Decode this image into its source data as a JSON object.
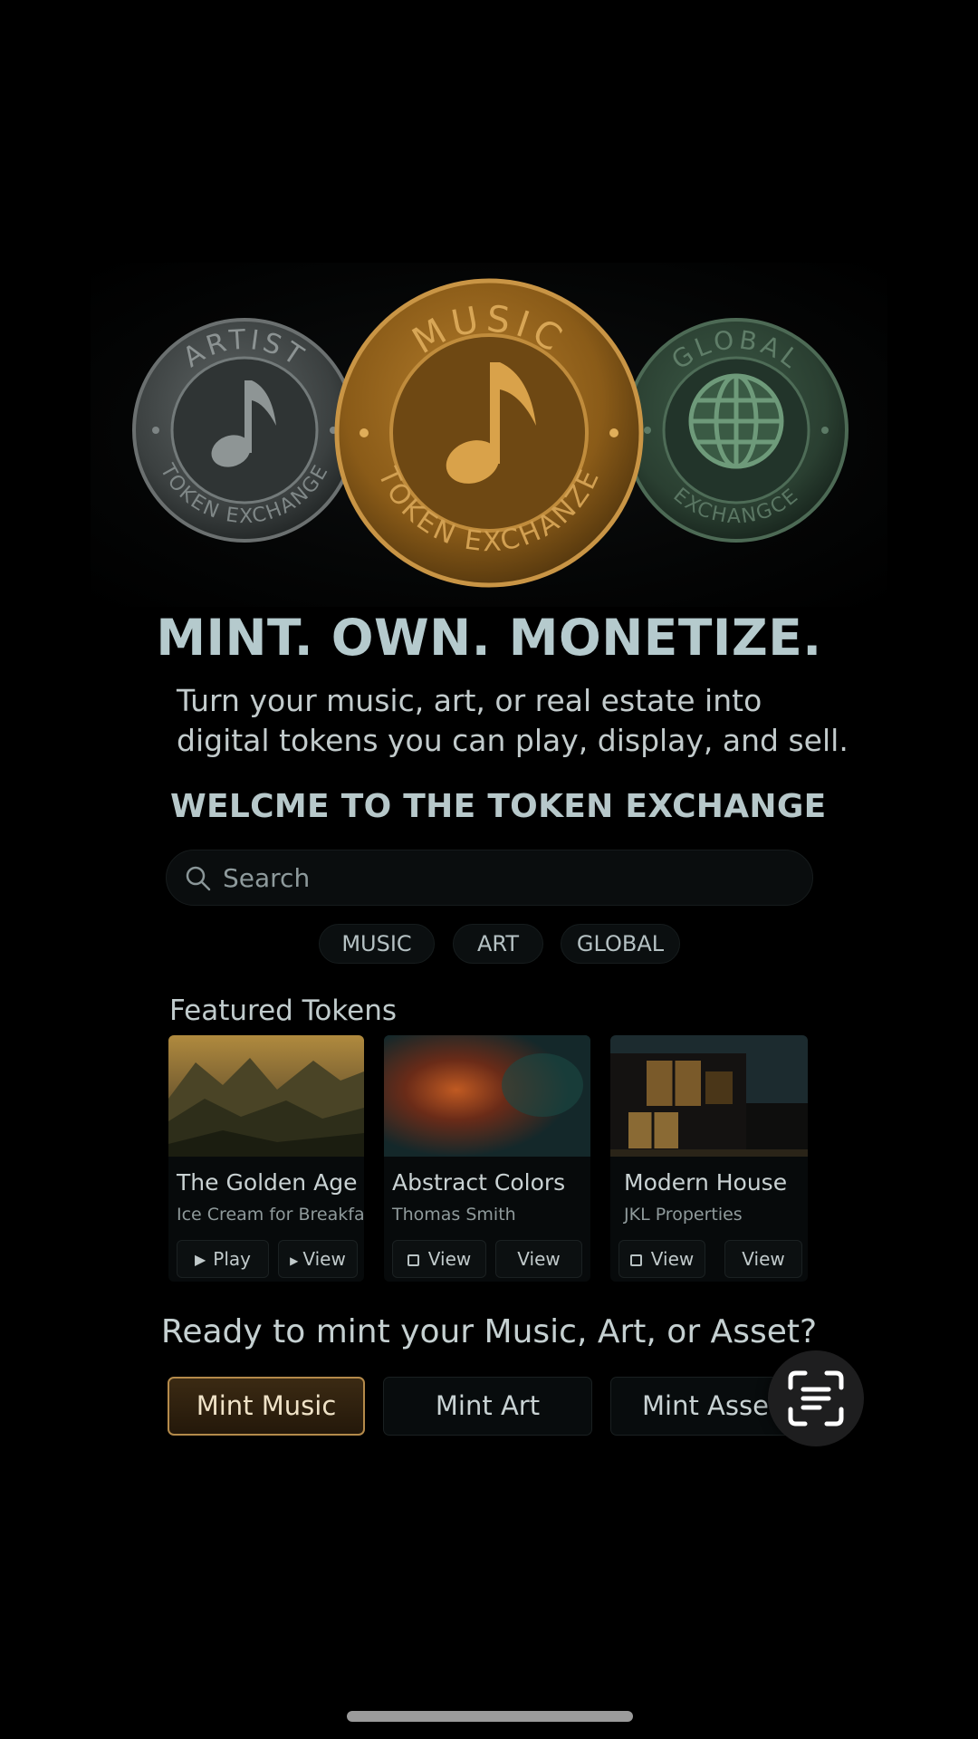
{
  "hero": {
    "coins": [
      {
        "top_text": "ARTIST",
        "bottom_text": "TOKEN EXCHANGE",
        "icon": "music-note-icon",
        "color": "#4a5050"
      },
      {
        "top_text": "MUSIC",
        "bottom_text": "TOKEN EXCHANZE",
        "icon": "music-note-icon",
        "color": "#a8701e"
      },
      {
        "top_text": "GLOBAL",
        "bottom_text": "EXCHANGCE",
        "icon": "globe-icon",
        "color": "#2f4a39"
      }
    ]
  },
  "headline": "MINT. OWN. MONETIZE.",
  "subhead": {
    "line1": "Turn your music, art, or real estate into",
    "line2": "digital tokens you can play, display, and sell."
  },
  "welcome": "WELCME TO THE TOKEN EXCHANGE",
  "search": {
    "placeholder": "Search",
    "icon": "search-icon"
  },
  "chips": [
    "MUSIC",
    "ART",
    "GLOBAL"
  ],
  "featured": {
    "title": "Featured Tokens",
    "cards": [
      {
        "title": "The Golden Age",
        "subtitle": "Ice Cream for Breakfast",
        "buttons": [
          "Play",
          "View"
        ],
        "thumb": "mountain landscape"
      },
      {
        "title": "Abstract Colors",
        "subtitle": "Thomas Smith",
        "buttons": [
          "View",
          "View"
        ],
        "thumb": "abstract painting"
      },
      {
        "title": "Modern House",
        "subtitle": "JKL Properties",
        "buttons": [
          "View",
          "View"
        ],
        "thumb": "modern house at dusk"
      }
    ]
  },
  "cta": {
    "question": "Ready to mint your Music, Art, or Asset?",
    "buttons": [
      "Mint Music",
      "Mint Art",
      "Mint Asset"
    ]
  },
  "colors": {
    "accent_gold": "#b48a4a",
    "background": "#000000",
    "text": "#c9d3d3"
  },
  "fab": {
    "icon": "text-scan-icon"
  }
}
